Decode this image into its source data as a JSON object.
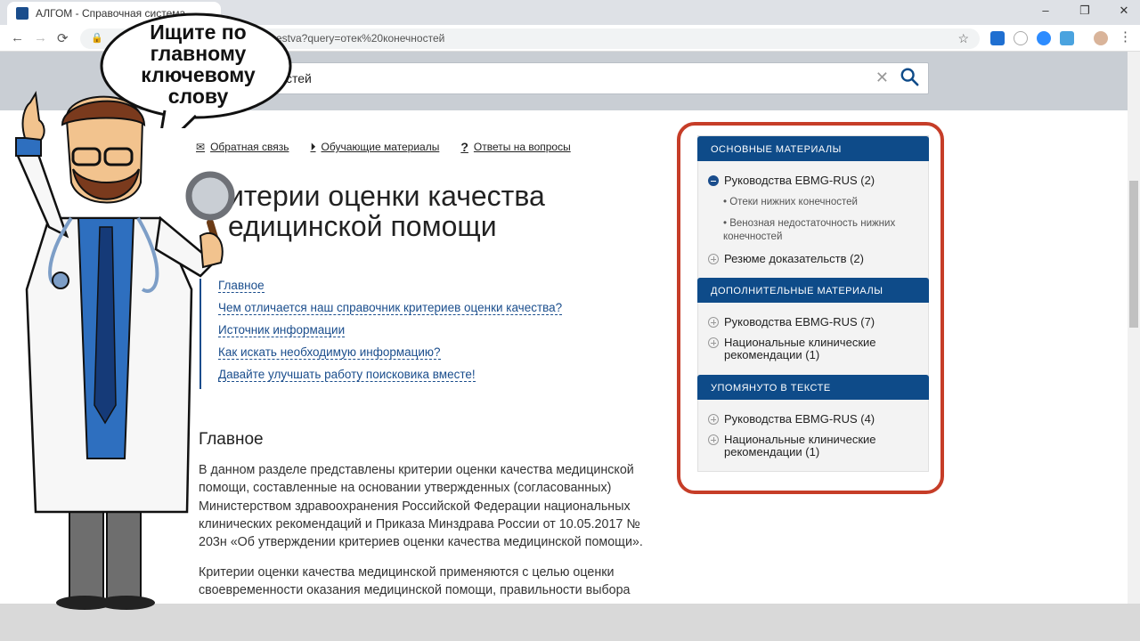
{
  "browser": {
    "tab_title": "АЛГОМ - Справочная система...",
    "url": "estva?query=отек%20конечностей",
    "window_buttons": [
      "–",
      "❐",
      "✕"
    ]
  },
  "search": {
    "value": "стей"
  },
  "toplinks": [
    {
      "label": "Обратная связь",
      "icon": "mail-icon"
    },
    {
      "label": "Обучающие материалы",
      "icon": "play-icon"
    },
    {
      "label": "Ответы на вопросы",
      "icon": "question-icon"
    }
  ],
  "page": {
    "title_line1": "итерии оценки качества",
    "title_line2": "едицинской помощи"
  },
  "toc": [
    "Главное",
    "Чем отличается наш справочник критериев оценки качества?",
    "Источник информации",
    "Как искать необходимую информацию?",
    "Давайте улучшать работу поисковика вместе!"
  ],
  "main": {
    "heading": "Главное",
    "para1": "В данном разделе представлены критерии оценки качества медицинской помощи, составленные на основании утвержденных (согласованных) Министерством здравоохранения Российской Федерации национальных клинических рекомендаций и Приказа Минздрава России от 10.05.2017 № 203н «Об утверждении критериев оценки качества медицинской помощи».",
    "para2": "Критерии оценки качества медицинской применяются с целью оценки своевременности оказания медицинской помощи, правильности выбора"
  },
  "sidebar": {
    "sec1": "ОСНОВНЫЕ МАТЕРИАЛЫ",
    "sec1_item1": "Руководства EBMG-RUS (2)",
    "sec1_sub1": "Отеки нижних конечностей",
    "sec1_sub2": "Венозная недостаточность нижних конечностей",
    "sec1_item2": "Резюме доказательств (2)",
    "sec2": "ДОПОЛНИТЕЛЬНЫЕ МАТЕРИАЛЫ",
    "sec2_item1": "Руководства EBMG-RUS (7)",
    "sec2_item2": "Национальные клинические рекомендации (1)",
    "sec3": "УПОМЯНУТО В ТЕКСТЕ",
    "sec3_item1": "Руководства EBMG-RUS (4)",
    "sec3_item2": "Национальные клинические рекомендации (1)"
  },
  "overlay": {
    "bubble_text": "Ищите по главному ключевому слову"
  },
  "colors": {
    "accent": "#0e4b89",
    "highlight_frame": "#c63d28"
  }
}
